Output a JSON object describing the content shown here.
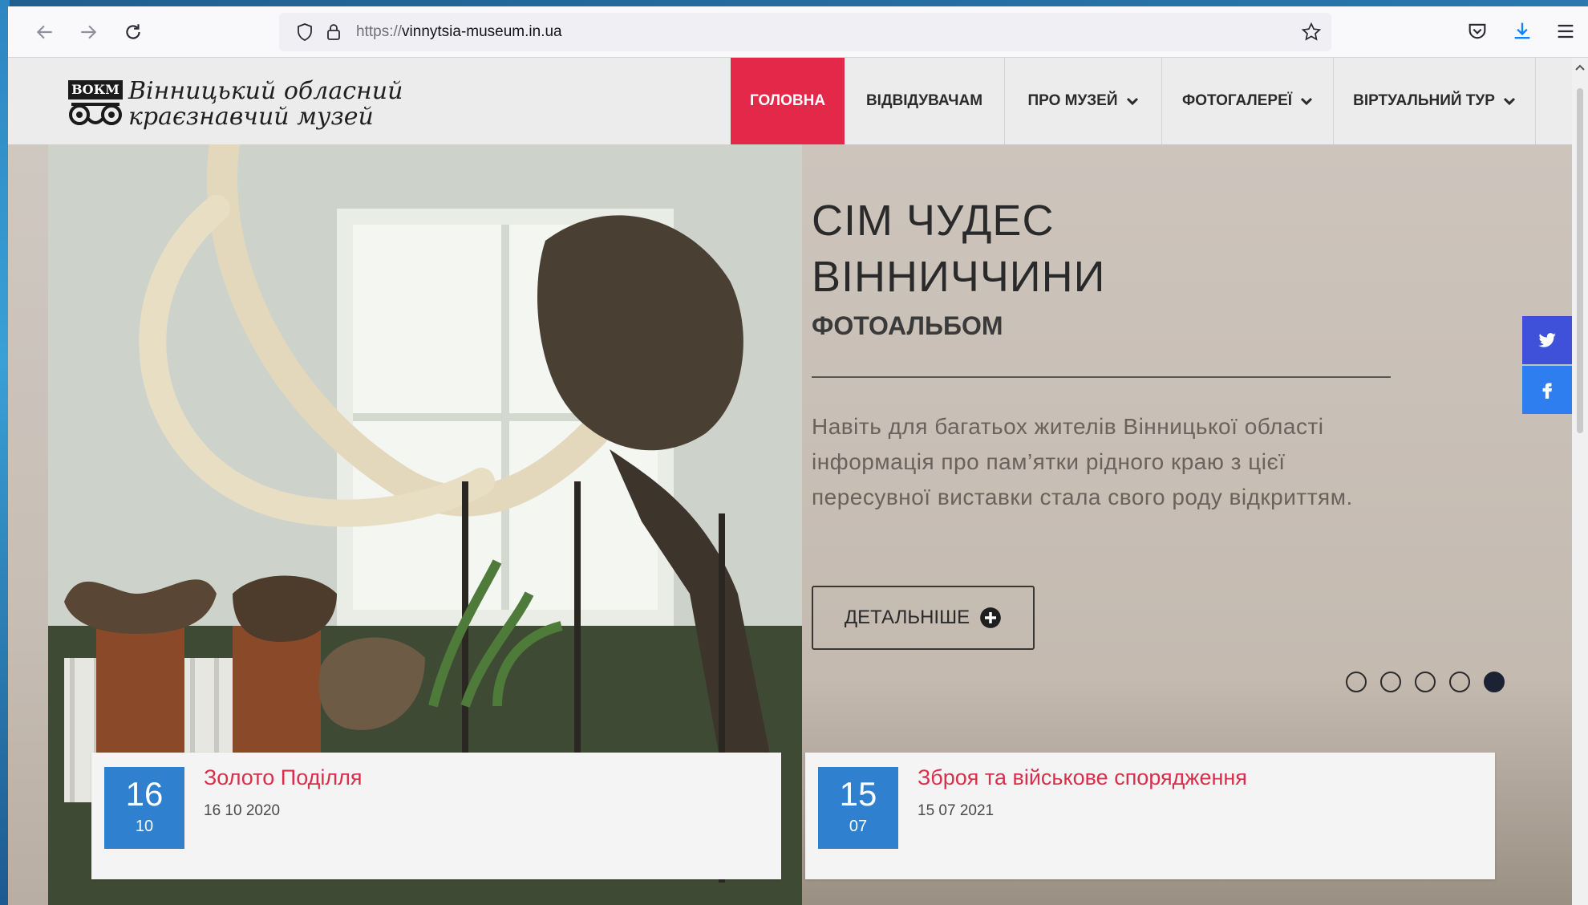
{
  "browser": {
    "url_proto": "https://",
    "url_host": "vinnytsia-museum.in.ua"
  },
  "site": {
    "logo_badge": "ВОКМ",
    "logo_line1": "Вінницький обласний",
    "logo_line2": "краєзнавчий музей"
  },
  "menu": {
    "items": [
      {
        "label": "ГОЛОВНА",
        "active": true
      },
      {
        "label": "ВІДВІДУВАЧАМ"
      },
      {
        "label": "ПРО МУЗЕЙ"
      },
      {
        "label": "ФОТОГАЛЕРЕЇ"
      },
      {
        "label": "ВІРТУАЛЬНИЙ ТУР"
      }
    ]
  },
  "slide": {
    "title_line1": "СІМ ЧУДЕС",
    "title_line2": "ВІННИЧЧИНИ",
    "subtitle": "ФОТОАЛЬБОМ",
    "description": "Навіть для багатьох жителів Вінницької області інформація про пам’ятки рідного краю з цієї пересувної виставки стала свого роду відкриттям.",
    "button_label": "ДЕТАЛЬНІШЕ",
    "active_dot": 5,
    "dot_count": 5
  },
  "news": [
    {
      "day": "16",
      "month": "10",
      "title": "Золото Поділля",
      "date": "16 10 2020"
    },
    {
      "day": "15",
      "month": "07",
      "title": "Зброя та військове спорядження",
      "date": "15 07 2021"
    }
  ],
  "colors": {
    "accent": "#e32849",
    "date_box": "#2f80cf",
    "twitter": "#3f51d8",
    "facebook": "#2f7ef0"
  }
}
